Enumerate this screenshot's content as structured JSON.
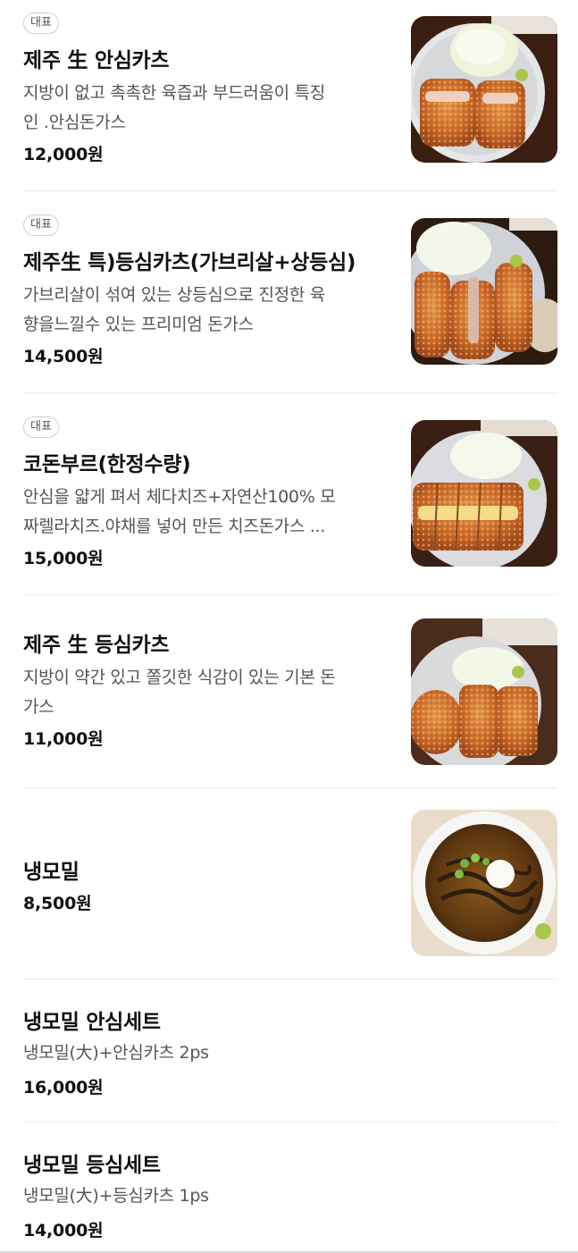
{
  "menu": {
    "items": [
      {
        "badge": "대표",
        "name": "제주 生 안심카츠",
        "desc_line1": "지방이 없고 촉촉한 육즙과 부드러움이 특징",
        "desc_line2": "인 .안심돈가스",
        "price": "12,000원",
        "image": "pork-tenderloin-katsu-photo"
      },
      {
        "badge": "대표",
        "name": "제주生 특)등심카츠(가브리살+상등심)",
        "desc_line1": "가브리살이 섞여 있는 상등심으로 진정한 육",
        "desc_line2": "향을느낄수 있는 프리미엄 돈가스",
        "price": "14,500원",
        "image": "premium-pork-loin-katsu-photo"
      },
      {
        "badge": "대표",
        "name": "코돈부르(한정수량)",
        "desc_line1": "안심을 얇게 펴서 체다치즈+자연산100% 모",
        "desc_line2": "짜렐라치즈.야채를 넣어 만든 치즈돈가스 ...",
        "price": "15,000원",
        "image": "cheese-katsu-photo"
      },
      {
        "name": "제주 生 등심카츠",
        "desc_line1": "지방이 약간 있고 쫄깃한 식감이 있는 기본 돈",
        "desc_line2": "가스",
        "price": "11,000원",
        "image": "pork-loin-katsu-photo"
      },
      {
        "name": "냉모밀",
        "price": "8,500원",
        "image": "cold-soba-photo"
      },
      {
        "name": "냉모밀 안심세트",
        "desc_line1": "냉모밀(大)+안심카츠 2ps",
        "price": "16,000원"
      },
      {
        "name": "냉모밀 등심세트",
        "desc_line1": "냉모밀(大)+등심카츠 1ps",
        "price": "14,000원"
      }
    ]
  },
  "colors": {
    "badge_border": "#cfcfcf",
    "text_primary": "#111111",
    "text_secondary": "#555555",
    "divider": "#ececec"
  }
}
